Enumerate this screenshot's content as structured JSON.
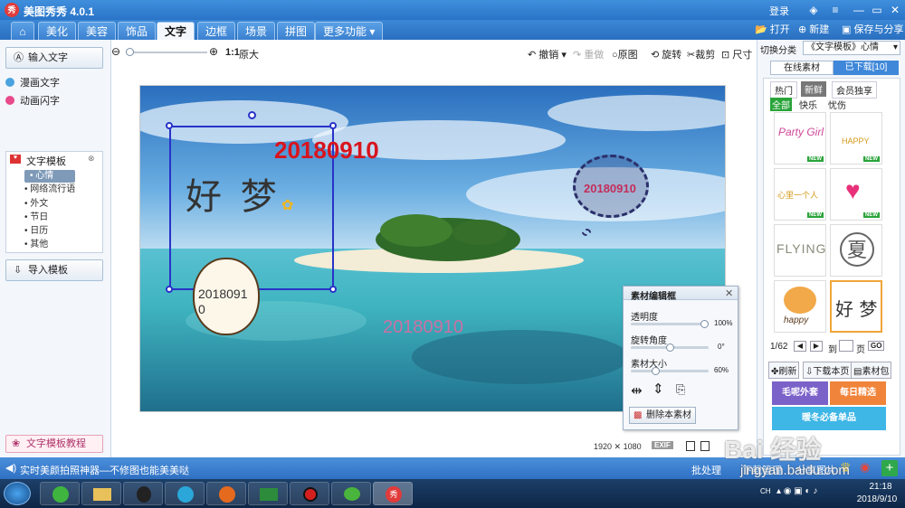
{
  "title": {
    "app": "美图秀秀 4.0.1",
    "logo": "秀",
    "login": "登录",
    "minimize": "—",
    "restore": "▭",
    "close": "✕"
  },
  "menu": {
    "tabs": [
      "美化",
      "美容",
      "饰品",
      "文字",
      "边框",
      "场景",
      "拼图",
      "更多功能"
    ],
    "active_index": 3,
    "open": "打开",
    "new": "新建",
    "save": "保存与分享"
  },
  "toolbar": {
    "zoom_ratio": "1:1",
    "original_size": "原大",
    "undo": "撤销",
    "redo": "重做",
    "original": "原图",
    "rotate": "旋转",
    "crop": "裁剪",
    "resize": "尺寸"
  },
  "left": {
    "input_text": "输入文字",
    "comic_text": "漫画文字",
    "animated_text": "动画闪字",
    "text_template": "文字模板",
    "categories": [
      "心情",
      "网络流行语",
      "外文",
      "节日",
      "日历",
      "其他"
    ],
    "import_template": "导入模板",
    "tutorial": "文字模板教程"
  },
  "canvas": {
    "date_red": "20180910",
    "handwritten": "好 梦",
    "bubble_date": "20180910",
    "bubble_text": "2018091\n0",
    "watermark": "20180910",
    "image_size": "1920 ✕ 1080",
    "exif": "EXIF"
  },
  "editor": {
    "title": "素材编辑框",
    "opacity_label": "透明度",
    "opacity_value": "100%",
    "opacity": 1.0,
    "rotation_label": "旋转角度",
    "rotation_value": "0°",
    "rotation": 0.5,
    "size_label": "素材大小",
    "size_value": "60%",
    "size": 0.3,
    "delete": "删除本素材"
  },
  "right": {
    "category_label": "切换分类",
    "category_value": "《文字模板》心情",
    "tab_online": "在线素材",
    "tab_downloaded": "已下载[10]",
    "filters": [
      "热门",
      "新鲜",
      "会员独享"
    ],
    "subfilters": [
      "全部",
      "快乐",
      "忧伤"
    ],
    "page": "1/62",
    "goto": "到",
    "page_unit": "页",
    "go": "GO",
    "refresh": "刷新",
    "download_page": "下载本页",
    "library": "素材包",
    "promo1": "毛呢外套",
    "promo2": "每日精选",
    "promo3": "暖冬必备单品",
    "thumbs": [
      {
        "text": "Party Girl",
        "badge": "NEW"
      },
      {
        "text": "HAPPY",
        "badge": "NEW"
      },
      {
        "text": "心里一个人",
        "badge": "NEW"
      },
      {
        "text": "♥",
        "badge": "NEW"
      },
      {
        "text": "FLYING",
        "badge": ""
      },
      {
        "text": "夏",
        "badge": ""
      },
      {
        "text": "happy",
        "badge": ""
      },
      {
        "text": "好 梦",
        "badge": ""
      }
    ]
  },
  "status": {
    "message": "实时美颜拍照神器—不修图也能美美哒",
    "batch": "批处理",
    "download_manage": "下载管理",
    "share": "分享图片"
  },
  "taskbar": {
    "time": "21:18",
    "date": "2018/9/10",
    "tray_label": "CH"
  },
  "watermark": {
    "site": "jingyan.baidu.com",
    "brand": "Bai 经验"
  }
}
